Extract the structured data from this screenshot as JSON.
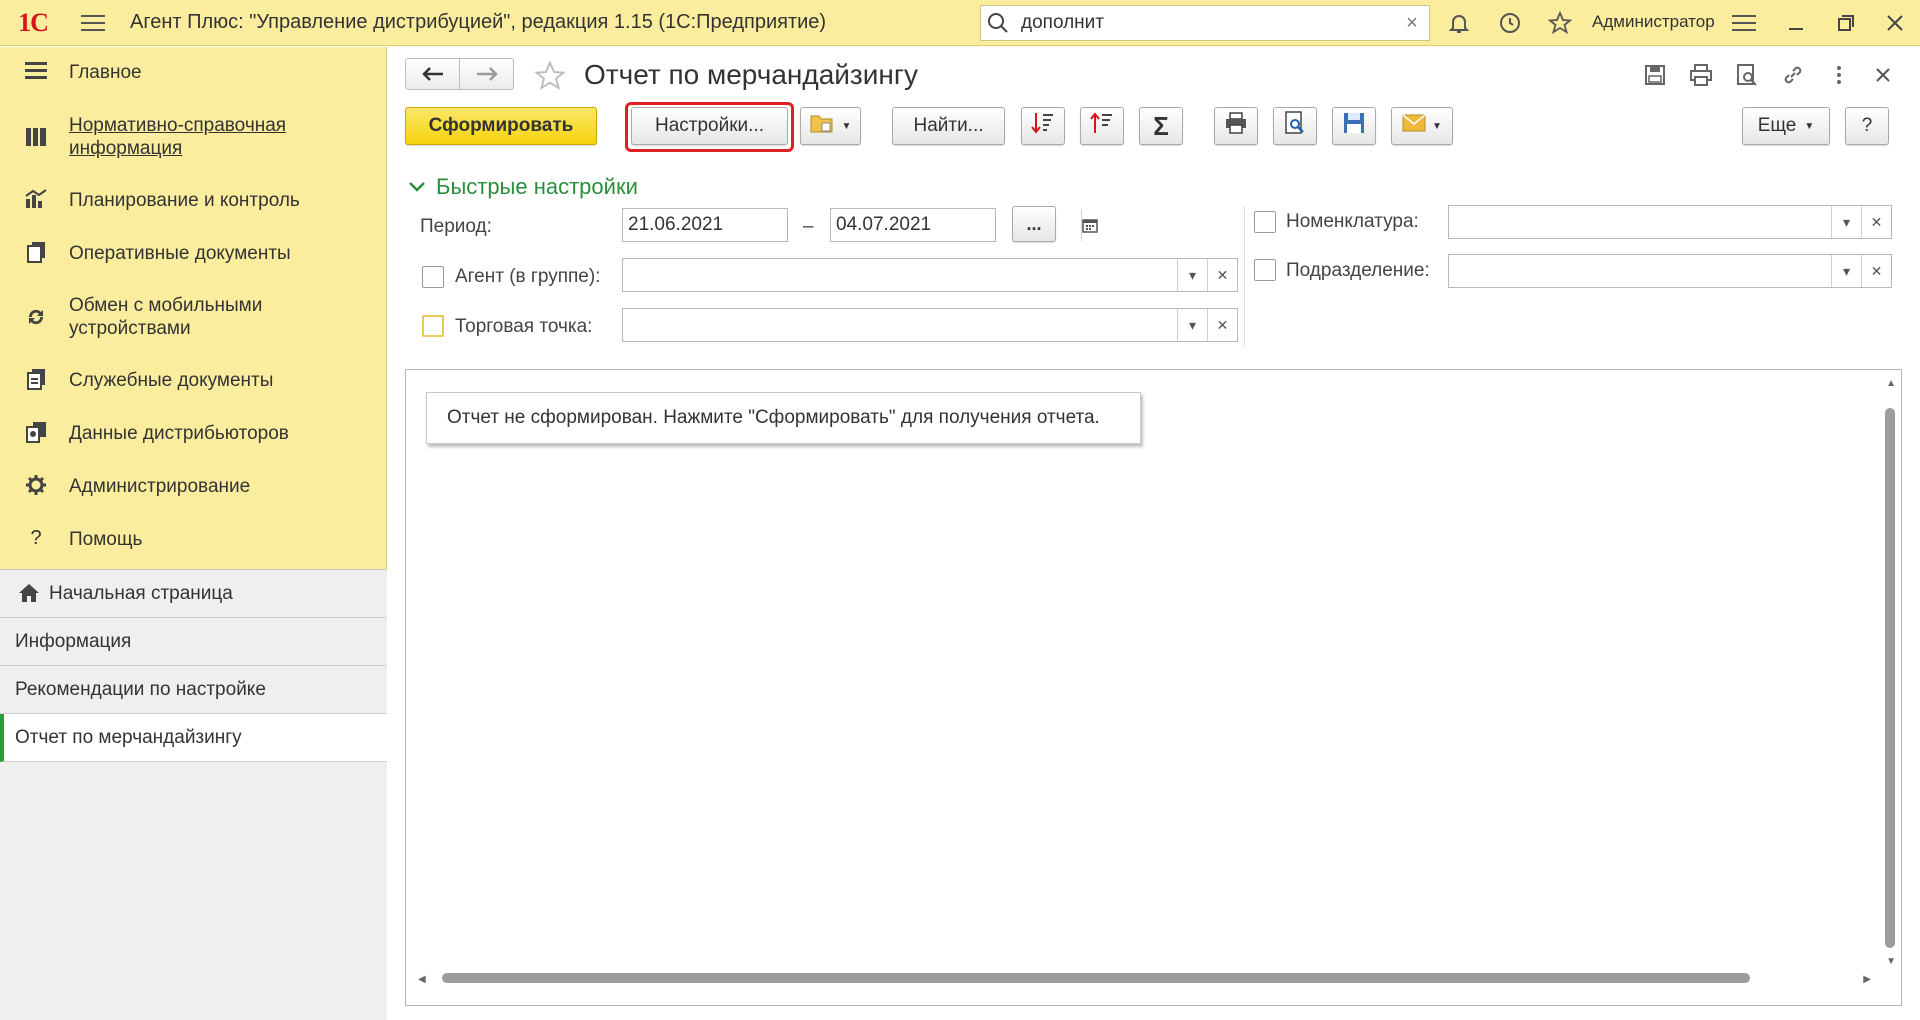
{
  "app": {
    "logo_text": "1С",
    "window_title": "Агент Плюс: \"Управление дистрибуцией\", редакция 1.15  (1С:Предприятие)",
    "search": {
      "value": "дополнит",
      "placeholder": ""
    },
    "user_name": "Администратор",
    "accent_color": "#FBED9E",
    "icons": [
      "menu-icon",
      "search-icon",
      "bell-icon",
      "history-icon",
      "star-icon",
      "settings-lines-icon",
      "minimize-icon",
      "restore-icon",
      "close-icon"
    ]
  },
  "sidebar": {
    "items": [
      {
        "label": "Главное",
        "icon": "list-icon"
      },
      {
        "label": "Нормативно-справочная информация",
        "icon": "reference-icon"
      },
      {
        "label": "Планирование и контроль",
        "icon": "chart-icon"
      },
      {
        "label": "Оперативные документы",
        "icon": "documents-icon"
      },
      {
        "label": "Обмен с мобильными устройствами",
        "icon": "sync-icon"
      },
      {
        "label": "Служебные документы",
        "icon": "service-docs-icon"
      },
      {
        "label": "Данные дистрибьюторов",
        "icon": "distributor-icon"
      },
      {
        "label": "Администрирование",
        "icon": "gear-icon"
      },
      {
        "label": "Помощь",
        "icon": "help-icon"
      }
    ],
    "open_windows": [
      {
        "label": "Начальная страница",
        "icon": "home-icon"
      },
      {
        "label": "Информация"
      },
      {
        "label": "Рекомендации по настройке"
      },
      {
        "label": "Отчет по мерчандайзингу",
        "active": true
      }
    ]
  },
  "form": {
    "title": "Отчет по мерчандайзингу",
    "toolbar": {
      "generate_label": "Сформировать",
      "settings_label": "Настройки...",
      "find_label": "Найти...",
      "more_label": "Еще",
      "help_label": "?",
      "sum_label": "Σ"
    },
    "quick_settings": {
      "title": "Быстрые настройки",
      "period_label": "Период:",
      "date_from": "21.06.2021",
      "date_separator": "–",
      "date_to": "04.07.2021",
      "period_more": "...",
      "agent_label": "Агент (в группе):",
      "agent_value": "",
      "outlet_label": "Торговая точка:",
      "outlet_value": "",
      "nomenclature_label": "Номенклатура:",
      "nomenclature_value": "",
      "department_label": "Подразделение:",
      "department_value": ""
    },
    "report_message": "Отчет не сформирован. Нажмите \"Сформировать\" для получения отчета."
  }
}
